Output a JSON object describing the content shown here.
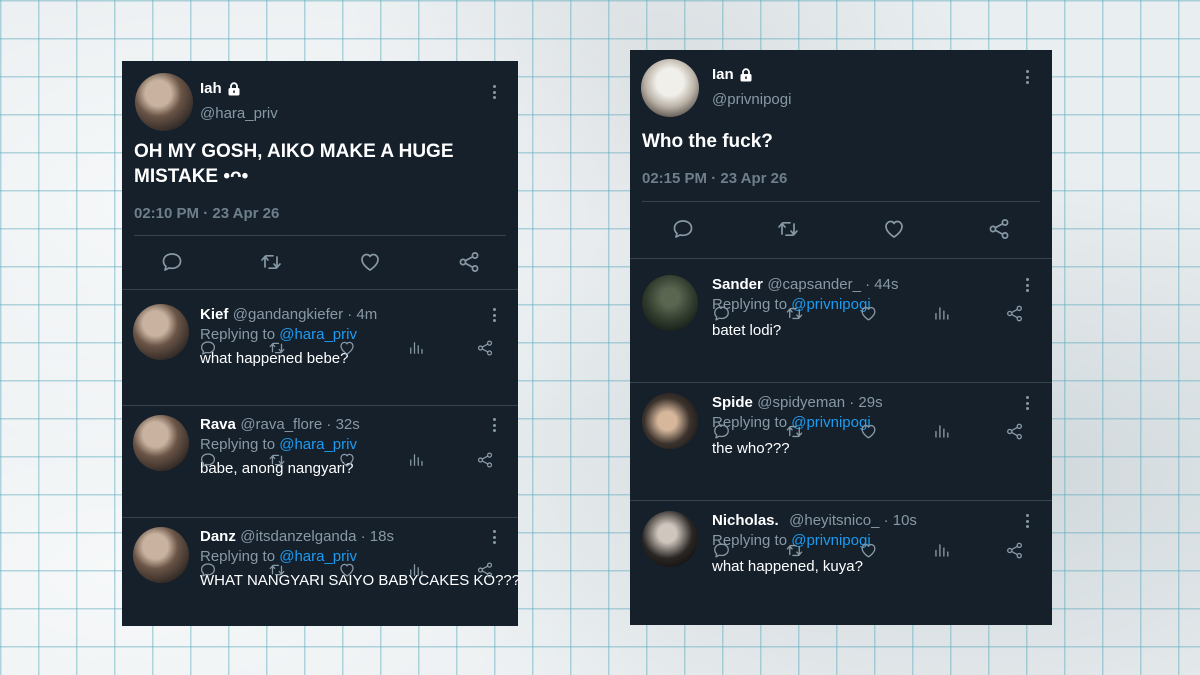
{
  "left_tweet": {
    "name": "Iah",
    "handle": "@hara_priv",
    "text": "OH MY GOSH, AIKO MAKE A HUGE MISTAKE •ᴖ•",
    "time": "02:10 PM · 23 Apr 26",
    "replies": [
      {
        "name": "Kief",
        "handle": "@gandangkiefer · 4m",
        "replying_prefix": "Replying to ",
        "replying_to": "@hara_priv",
        "text": "what happened bebe?"
      },
      {
        "name": "Rava",
        "handle": "@rava_flore · 32s",
        "replying_prefix": "Replying to ",
        "replying_to": "@hara_priv",
        "text": "babe, anong nangyari?"
      },
      {
        "name": "Danz",
        "handle": "@itsdanzelganda · 18s",
        "replying_prefix": "Replying to ",
        "replying_to": "@hara_priv",
        "text": "WHAT NANGYARI SAIYO BABYCAKES KO???"
      }
    ]
  },
  "right_tweet": {
    "name": "Ian",
    "handle": "@privnipogi",
    "text": "Who the fuck?",
    "time": "02:15 PM · 23 Apr 26",
    "replies": [
      {
        "name": "Sander",
        "handle": "@capsander_ · 44s",
        "replying_prefix": "Replying to ",
        "replying_to": "@privnipogi",
        "text": "batet lodi?"
      },
      {
        "name": "Spide",
        "handle": "@spidyeman · 29s",
        "replying_prefix": "Replying to ",
        "replying_to": "@privnipogi",
        "text": "the who???"
      },
      {
        "name": "Nicholas.",
        "handle": "@heyitsnico_ · 10s",
        "replying_prefix": "Replying to ",
        "replying_to": "@privnipogi",
        "text": "what happened, kuya?"
      }
    ]
  },
  "icons": [
    "lock-icon",
    "more-icon",
    "reply-icon",
    "retweet-icon",
    "like-icon",
    "share-icon",
    "analytics-icon"
  ],
  "colors": {
    "card_bg": "#15202b",
    "mention": "#1d9bf0",
    "muted": "#8899a6",
    "divider": "#38444d",
    "grid": "#5aaabe"
  }
}
